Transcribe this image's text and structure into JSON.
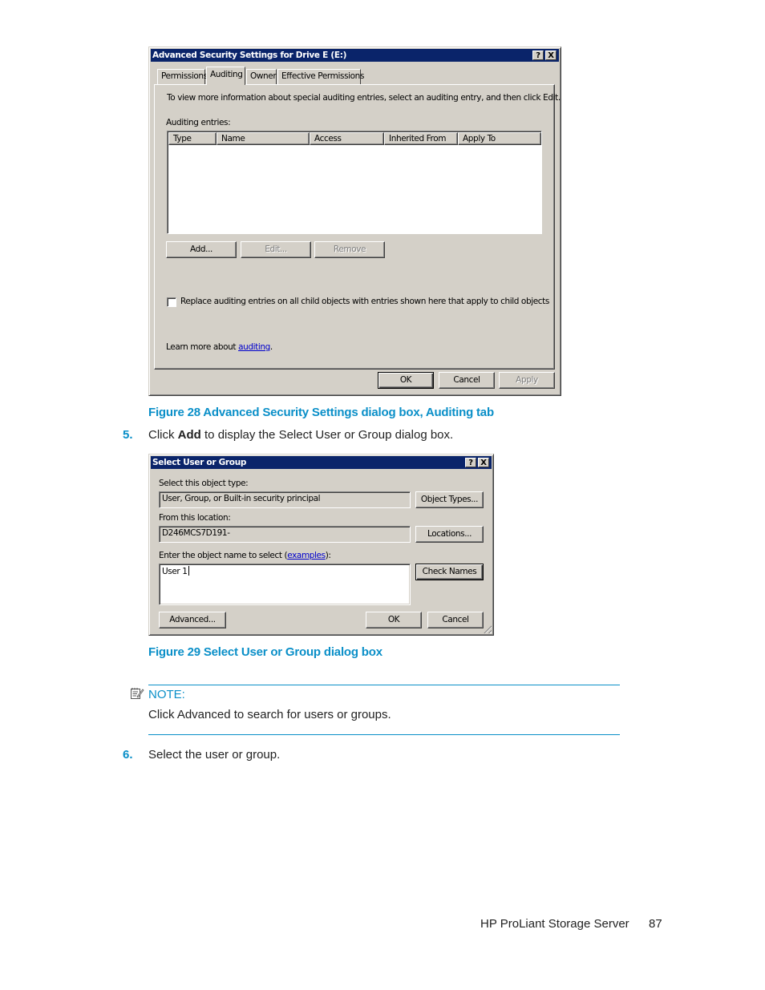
{
  "figure28": {
    "dialog": {
      "title": "Advanced Security Settings for Drive E (E:)",
      "help_icon": "?",
      "close_icon": "X",
      "tabs": [
        {
          "label": "Permissions",
          "active": false
        },
        {
          "label": "Auditing",
          "active": true
        },
        {
          "label": "Owner",
          "active": false
        },
        {
          "label": "Effective Permissions",
          "active": false
        }
      ],
      "info_text": "To view more information about special auditing entries, select an auditing entry, and then click Edit.",
      "entries_label": "Auditing entries:",
      "columns": [
        "Type",
        "Name",
        "Access",
        "Inherited From",
        "Apply To"
      ],
      "rows": [],
      "add_button": "Add...",
      "edit_button": "Edit...",
      "remove_button": "Remove",
      "replace_checkbox": {
        "label": "Replace auditing entries on all child objects with entries shown here that apply to child objects",
        "checked": false
      },
      "learn_more_prefix": "Learn more about ",
      "learn_more_link": "auditing",
      "learn_more_suffix": ".",
      "ok_button": "OK",
      "cancel_button": "Cancel",
      "apply_button": "Apply"
    },
    "caption": "Figure 28 Advanced Security Settings dialog box, Auditing tab"
  },
  "step5": {
    "number": "5.",
    "text_before": "Click ",
    "bold": "Add",
    "text_after": " to display the Select User or Group dialog box."
  },
  "figure29": {
    "dialog": {
      "title": "Select User or Group",
      "help_icon": "?",
      "close_icon": "X",
      "object_type_label": "Select this object type:",
      "object_type_value": "User, Group, or Built-in security principal",
      "object_types_button": "Object Types...",
      "location_label": "From this location:",
      "location_value": "D246MCS7D191-",
      "locations_button": "Locations...",
      "object_name_label_prefix": "Enter the object name to select (",
      "object_name_link": "examples",
      "object_name_label_suffix": "):",
      "object_name_value": "User 1",
      "check_names_button": "Check Names",
      "advanced_button": "Advanced...",
      "ok_button": "OK",
      "cancel_button": "Cancel"
    },
    "caption": "Figure 29 Select User or Group dialog box"
  },
  "note": {
    "label": "NOTE:",
    "text": "Click Advanced to search for users or groups."
  },
  "step6": {
    "number": "6.",
    "text": "Select the user or group."
  },
  "footer": {
    "title": "HP ProLiant Storage Server",
    "page_number": "87"
  },
  "colors": {
    "accent": "#0a8fc8",
    "titlebar": "#0a246a",
    "dialog_bg": "#d4d0c8"
  }
}
